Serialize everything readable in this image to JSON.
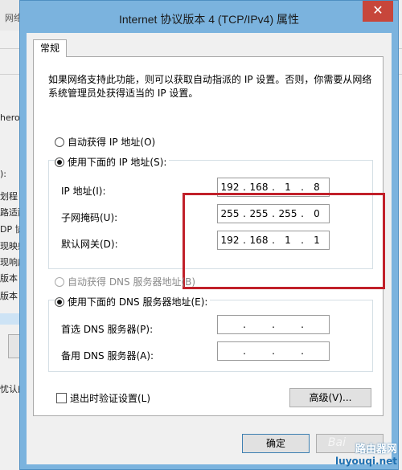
{
  "dialog": {
    "title": "Internet 协议版本 4 (TCP/IPv4) 属性",
    "close_symbol": "✕",
    "tab_label": "常规",
    "description": "如果网络支持此功能，则可以获取自动指派的 IP 设置。否则，你需要从网络系统管理员处获得适当的 IP 设置。",
    "ip_section": {
      "auto_label": "自动获得 IP 地址(O)",
      "manual_label": "使用下面的 IP 地址(S):",
      "auto_selected": false,
      "manual_selected": true,
      "fields": [
        {
          "label": "IP 地址(I):",
          "octets": [
            "192",
            "168",
            "1",
            "8"
          ]
        },
        {
          "label": "子网掩码(U):",
          "octets": [
            "255",
            "255",
            "255",
            "0"
          ]
        },
        {
          "label": "默认网关(D):",
          "octets": [
            "192",
            "168",
            "1",
            "1"
          ]
        }
      ]
    },
    "dns_section": {
      "auto_label": "自动获得 DNS 服务器地址(B)",
      "manual_label": "使用下面的 DNS 服务器地址(E):",
      "auto_selected": false,
      "manual_selected": true,
      "auto_disabled": true,
      "fields": [
        {
          "label": "首选 DNS 服务器(P):",
          "octets": [
            "",
            "",
            "",
            ""
          ]
        },
        {
          "label": "备用 DNS 服务器(A):",
          "octets": [
            "",
            "",
            "",
            ""
          ]
        }
      ]
    },
    "validate_checkbox": {
      "label": "退出时验证设置(L)",
      "checked": false
    },
    "advanced_button": "高级(V)...",
    "ok_button": "确定",
    "separator": "."
  },
  "background": {
    "title_fragment": "网络",
    "fragments": [
      "hero",
      "):",
      "划程",
      "路适配",
      "DP 协",
      "现映射",
      "现响应",
      "版本",
      "版本",
      "忧认的"
    ]
  },
  "watermark": {
    "cn": "路由器网",
    "en": "luyouqi.net",
    "bai": "Bai"
  },
  "colors": {
    "titlebar": "#7bb3de",
    "close": "#c7463b",
    "highlight_box": "#c1202a"
  }
}
